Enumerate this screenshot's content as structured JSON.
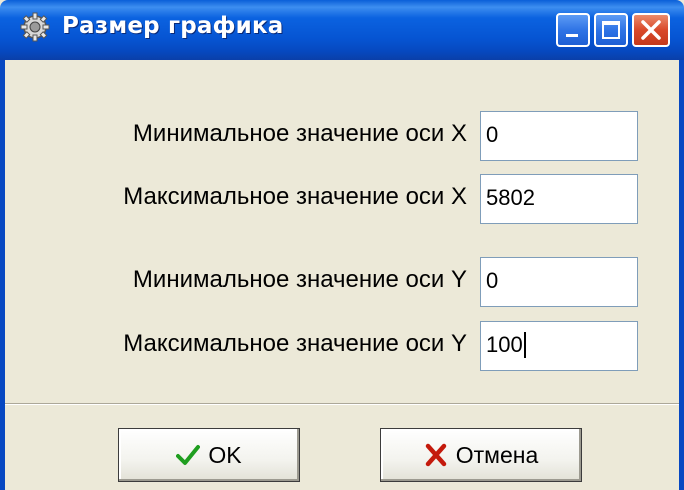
{
  "window": {
    "title": "Размер графика",
    "icon": "gear-icon",
    "controls": [
      "minimize-icon",
      "maximize-icon",
      "close-icon"
    ]
  },
  "form": {
    "x_min": {
      "label": "Минимальное значение оси X",
      "value": "0"
    },
    "x_max": {
      "label": "Максимальное значение оси X",
      "value": "5802"
    },
    "y_min": {
      "label": "Минимальное значение оси Y",
      "value": "0"
    },
    "y_max": {
      "label": "Максимальное значение оси Y",
      "value": "100"
    }
  },
  "buttons": {
    "ok": {
      "label": "OK",
      "icon": "checkmark-icon",
      "color": "#1f9e1f"
    },
    "cancel": {
      "label": "Отмена",
      "icon": "x-mark-icon",
      "color": "#c41a0c"
    }
  },
  "colors": {
    "titlebar": "#0654d2",
    "window_bg": "#ece9d8",
    "close_button": "#d9492a"
  }
}
